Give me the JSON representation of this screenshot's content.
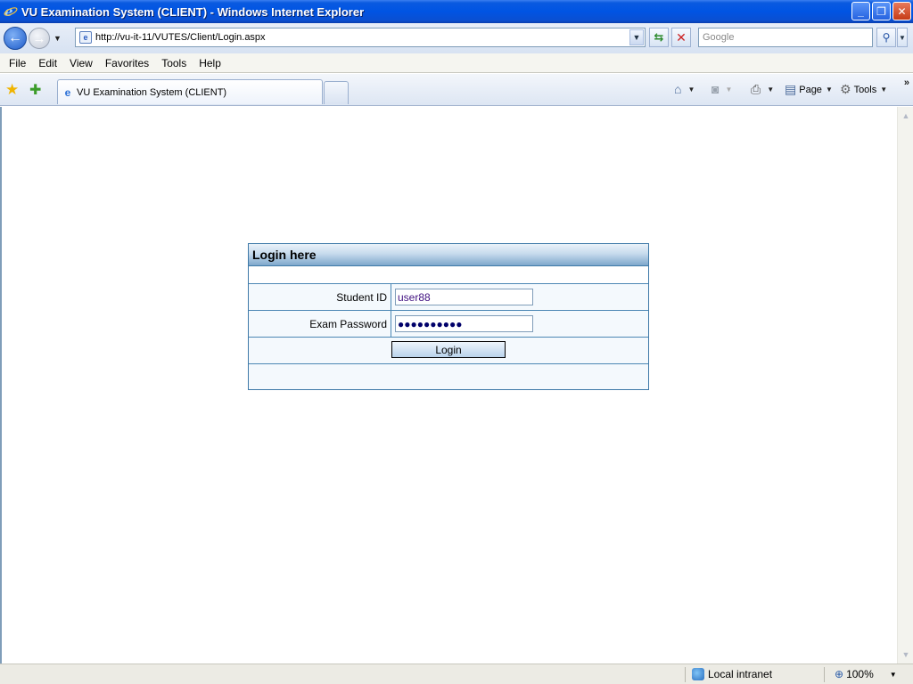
{
  "window": {
    "title": "VU Examination System (CLIENT) - Windows Internet Explorer",
    "minimize": "_",
    "restore": "❐",
    "close": "✕"
  },
  "address": {
    "url": "http://vu-it-11/VUTES/Client/Login.aspx",
    "search_placeholder": "Google"
  },
  "menu": {
    "items": [
      "File",
      "Edit",
      "View",
      "Favorites",
      "Tools",
      "Help"
    ]
  },
  "tabs": {
    "active_label": "VU Examination System (CLIENT)"
  },
  "commands": {
    "page_label": "Page",
    "tools_label": "Tools"
  },
  "login": {
    "header": "Login here",
    "student_id_label": "Student ID",
    "student_id_value": "user88",
    "password_label": "Exam Password",
    "password_value": "●●●●●●●●●●",
    "login_button": "Login"
  },
  "status": {
    "zone": "Local intranet",
    "zoom": "100%"
  },
  "icons": {
    "back": "back-arrow-icon",
    "forward": "forward-arrow-icon",
    "refresh": "refresh-icon",
    "stop": "stop-icon",
    "search": "search-icon",
    "favorites": "star-icon",
    "add_favorite": "add-favorite-icon",
    "home": "home-icon",
    "feeds": "feeds-icon",
    "print": "printer-icon",
    "page": "page-icon",
    "tools": "gear-icon"
  },
  "colors": {
    "titlebar": "#0054e3",
    "panel_border": "#3e79a8",
    "panel_header": "#7ea7cb"
  }
}
